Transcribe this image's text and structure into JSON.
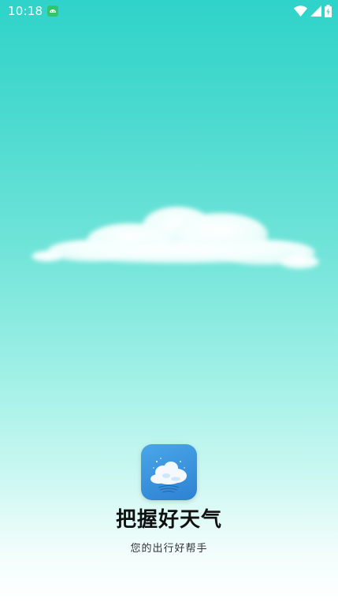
{
  "status_bar": {
    "time": "10:18",
    "icons": [
      "android-notification-icon",
      "wifi-icon",
      "cell-signal-icon",
      "battery-charging-icon"
    ]
  },
  "splash": {
    "app_name": "把握好天气",
    "tagline": "您的出行好帮手",
    "icon": "cloud-weather-app-icon"
  },
  "colors": {
    "sky_top": "#2fd3c9",
    "sky_bottom": "#ffffff",
    "app_icon_bg": "#3a94dd"
  }
}
